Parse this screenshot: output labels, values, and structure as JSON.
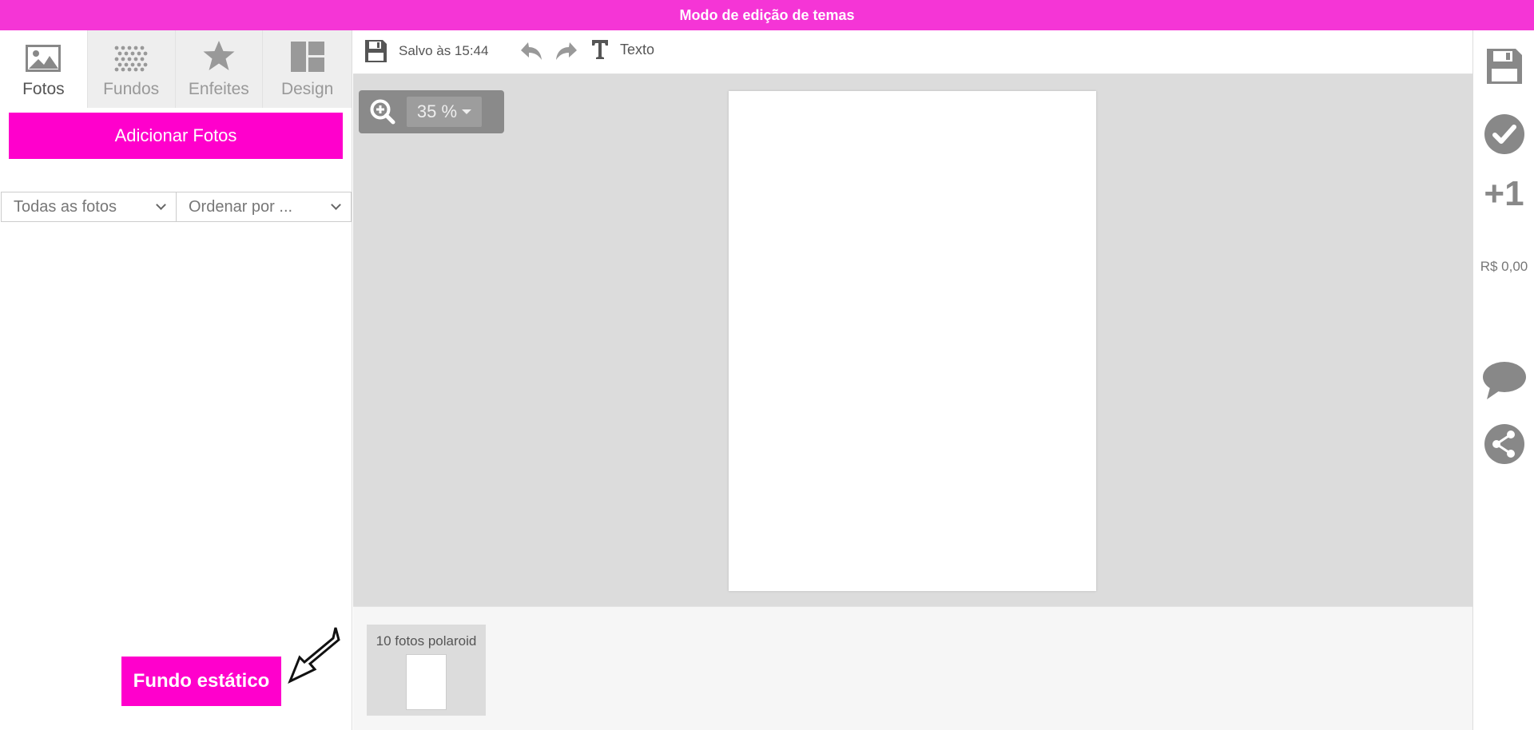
{
  "banner": {
    "title": "Modo de edição de temas",
    "color": "#f535d6"
  },
  "left_panel": {
    "tabs": [
      {
        "label": "Fotos",
        "icon": "image-icon",
        "active": true
      },
      {
        "label": "Fundos",
        "icon": "pattern-icon",
        "active": false
      },
      {
        "label": "Enfeites",
        "icon": "star-icon",
        "active": false
      },
      {
        "label": "Design",
        "icon": "layout-icon",
        "active": false
      }
    ],
    "add_photos_label": "Adicionar Fotos",
    "filter_select": "Todas as fotos",
    "sort_select": "Ordenar por ...",
    "static_background_label": "Fundo estático",
    "accent_color": "#ff00cc"
  },
  "toolbar": {
    "saved_text": "Salvo às 15:44",
    "text_tool_label": "Texto",
    "icons": [
      "save-icon",
      "undo-icon",
      "redo-icon",
      "text-icon"
    ]
  },
  "canvas": {
    "zoom_value": "35 %"
  },
  "pages_strip": {
    "thumbnail_label": "10 fotos polaroid"
  },
  "right_sidebar": {
    "plus_one_label": "+1",
    "price": "R$ 0,00",
    "icons": [
      "save-icon",
      "check-circle-icon",
      "chat-icon",
      "share-icon"
    ]
  }
}
